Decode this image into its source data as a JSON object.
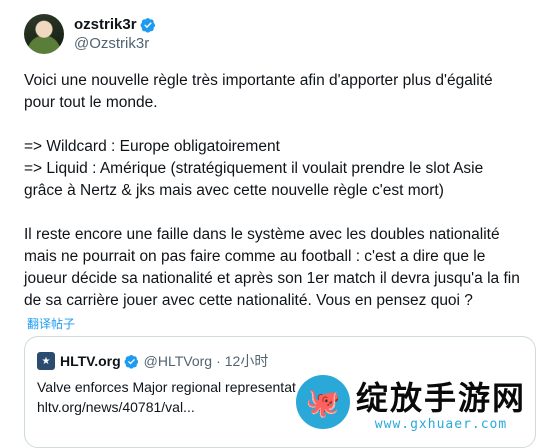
{
  "author": {
    "display_name": "ozstrik3r",
    "handle": "@Ozstrik3r",
    "verified_icon": "verified-badge-icon"
  },
  "tweet": {
    "paragraphs": [
      "Voici une nouvelle règle très importante afin d'apporter plus d'égalité\npour tout le monde.",
      "=> Wildcard : Europe obligatoirement\n=> Liquid : Amérique (stratégiquement il voulait prendre le slot Asie\ngrâce à Nertz & jks mais avec cette nouvelle règle c'est mort)",
      "Il reste encore une faille dans le système avec les doubles nationalité\nmais ne pourrait on pas faire comme au football : c'est a dire que le\njoueur décide sa nationalité et après son 1er match il devra jusqu'a la fin\nde sa carrière jouer avec cette nationalité. Vous en pensez quoi ?"
    ],
    "translate_label": "翻译帖子"
  },
  "quote": {
    "name": "HLTV.org",
    "handle": "@HLTVorg",
    "separator": "·",
    "time": "12小时",
    "line1": "Valve enforces Major regional representat",
    "line2": "hltv.org/news/40781/val..."
  },
  "watermark": {
    "title": "绽放手游网",
    "url": "www.gxhuaer.com"
  },
  "colors": {
    "accent": "#1d9bf0",
    "text": "#0f1419",
    "muted": "#536471",
    "border": "#cfd9de"
  }
}
